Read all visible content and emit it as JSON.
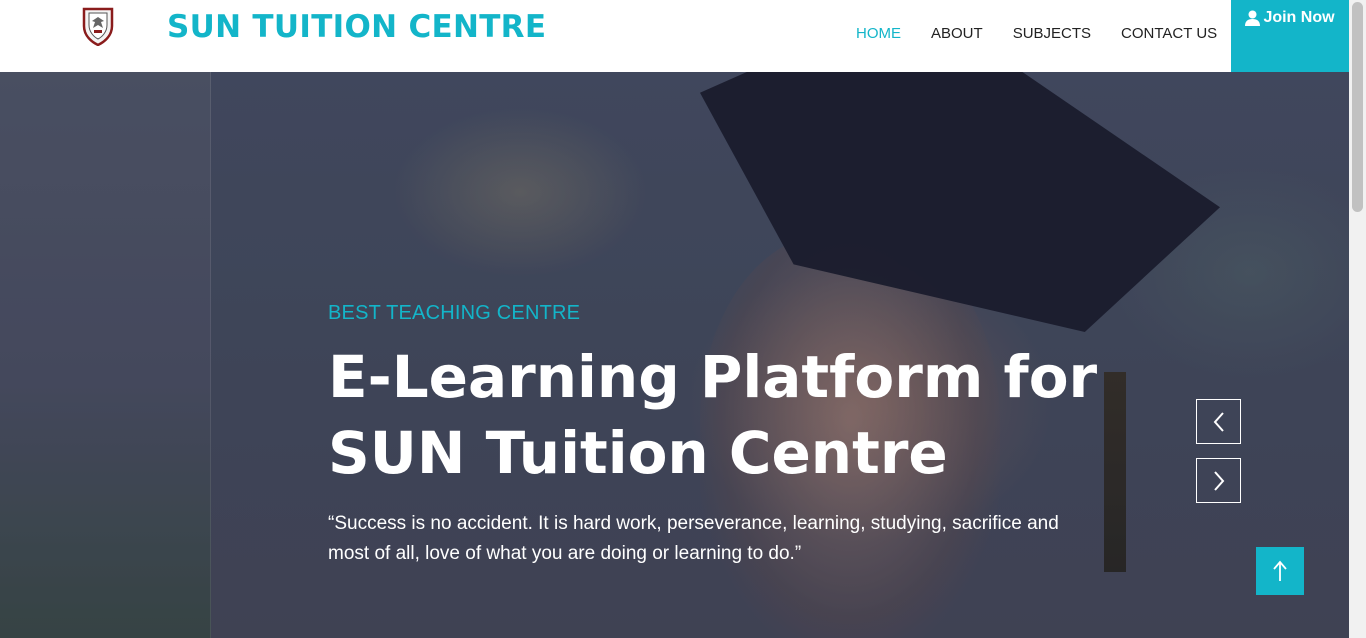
{
  "navbar": {
    "brand": "SUN TUITION CENTRE",
    "logo_icon": "shield-crest-icon",
    "links": [
      {
        "label": "HOME",
        "active": true
      },
      {
        "label": "ABOUT",
        "active": false
      },
      {
        "label": "SUBJECTS",
        "active": false
      },
      {
        "label": "CONTACT US",
        "active": false
      }
    ],
    "join_label": "Join Now",
    "join_icon": "user-icon"
  },
  "hero": {
    "eyebrow": "BEST TEACHING CENTRE",
    "headline_line1": "E-Learning Platform for",
    "headline_line2": "SUN Tuition Centre",
    "quote": "“Success is no accident. It is hard work, perseverance, learning, studying, sacrifice and most of all, love of what you are doing or learning to do.”",
    "prev_icon": "chevron-left-icon",
    "next_icon": "chevron-right-icon"
  },
  "back_to_top_icon": "arrow-up-icon",
  "colors": {
    "accent": "#13b5c9",
    "nav_text": "#222222",
    "hero_text": "#ffffff"
  }
}
